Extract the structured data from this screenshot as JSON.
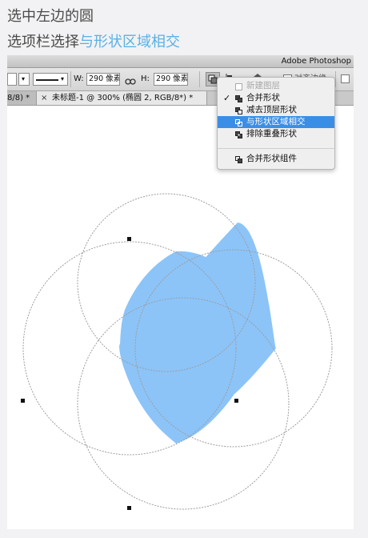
{
  "instructions": {
    "line1": "选中左边的圆",
    "line2_prefix": "选项栏选择",
    "line2_highlight": "与形状区域相交"
  },
  "window": {
    "app_title": "Adobe Photoshop"
  },
  "options_bar": {
    "width_label": "W:",
    "width_value": "290 像素",
    "height_label": "H:",
    "height_value": "290 像素",
    "align_edges_label": "对齐边缘"
  },
  "tabs": [
    {
      "label": "8/8) *"
    },
    {
      "close": "×",
      "label": "未标题-1 @ 300% (椭圆 2, RGB/8*) *"
    }
  ],
  "path_operations_menu": {
    "items": [
      {
        "label": "新建图层",
        "enabled": false,
        "checked": false,
        "selected": false
      },
      {
        "label": "合并形状",
        "enabled": true,
        "checked": true,
        "selected": false
      },
      {
        "label": "减去顶层形状",
        "enabled": true,
        "checked": false,
        "selected": false
      },
      {
        "label": "与形状区域相交",
        "enabled": true,
        "checked": false,
        "selected": true
      },
      {
        "label": "排除重叠形状",
        "enabled": true,
        "checked": false,
        "selected": false
      },
      {
        "label": "合并形状组件",
        "enabled": true,
        "checked": false,
        "selected": false
      }
    ],
    "check_mark": "✓"
  },
  "colors": {
    "highlight_text": "#5ab0e6",
    "intersection_fill": "#8cc4f8",
    "menu_selection": "#3a8ee6"
  }
}
